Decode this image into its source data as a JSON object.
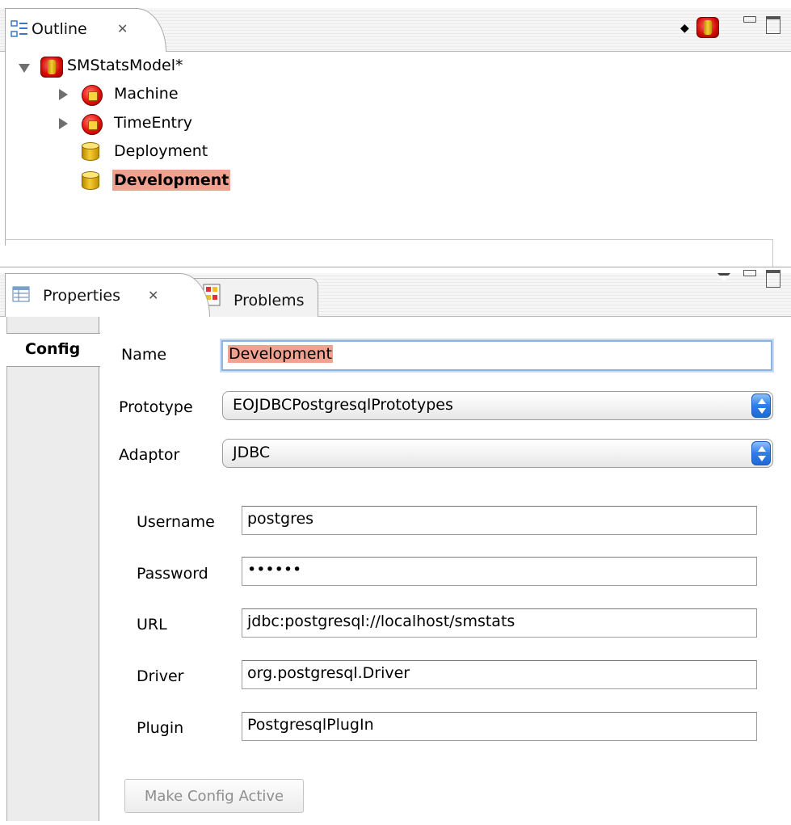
{
  "outline": {
    "tab_label": "Outline",
    "close_glyph": "✕",
    "toolbar": {
      "link_icon": "link-icon",
      "model_icon": "model-icon",
      "minimize_icon": "minimize-icon",
      "maximize_icon": "maximize-icon"
    },
    "tree": [
      {
        "label": "SMStatsModel*",
        "icon": "model-icon",
        "expanded": true
      },
      {
        "label": "Machine",
        "icon": "entity-icon",
        "expanded": false
      },
      {
        "label": "TimeEntry",
        "icon": "entity-icon",
        "expanded": false
      },
      {
        "label": "Deployment",
        "icon": "database-icon"
      },
      {
        "label": "Development",
        "icon": "database-icon",
        "selected": true
      }
    ]
  },
  "properties": {
    "tabs": [
      {
        "label": "Properties",
        "icon": "properties-icon",
        "active": true
      },
      {
        "label": "Problems",
        "icon": "problems-icon",
        "active": false
      }
    ],
    "close_glyph": "✕",
    "side_tab": "Config",
    "form": {
      "name_label": "Name",
      "name_value": "Development",
      "prototype_label": "Prototype",
      "prototype_value": "EOJDBCPostgresqlPrototypes",
      "adaptor_label": "Adaptor",
      "adaptor_value": "JDBC",
      "username_label": "Username",
      "username_value": "postgres",
      "password_label": "Password",
      "password_value": "••••••",
      "url_label": "URL",
      "url_value": "jdbc:postgresql://localhost/smstats",
      "driver_label": "Driver",
      "driver_value": "org.postgresql.Driver",
      "plugin_label": "Plugin",
      "plugin_value": "PostgresqlPlugIn"
    },
    "make_active_label": "Make Config Active"
  },
  "colors": {
    "selection": "#f0a18f",
    "focus_ring": "#8fb3e0",
    "select_arrows": "#2d7fe8"
  }
}
